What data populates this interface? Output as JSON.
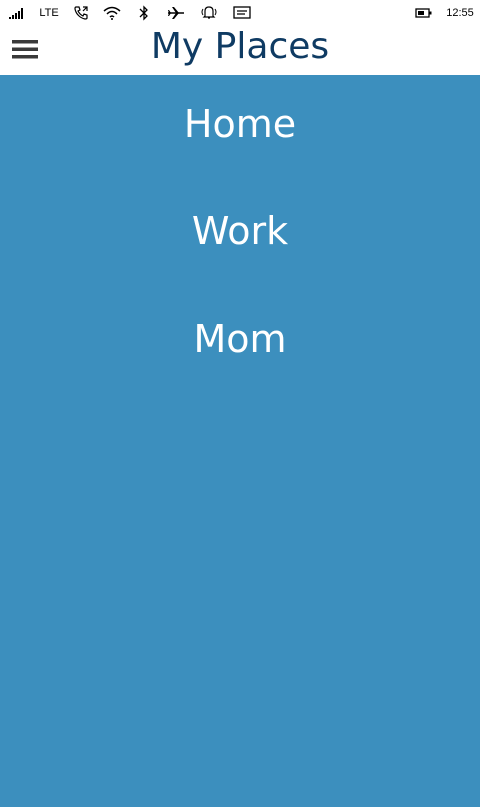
{
  "status_bar": {
    "network": "LTE",
    "time": "12:55",
    "icons": [
      "signal-icon",
      "lte-label",
      "call-icon",
      "wifi-icon",
      "bluetooth-icon",
      "airplane-icon",
      "notification-bell-icon",
      "message-icon",
      "battery-icon"
    ]
  },
  "header": {
    "title": "My Places",
    "menu_icon": "hamburger-menu-icon"
  },
  "places": [
    {
      "label": "Home"
    },
    {
      "label": "Work"
    },
    {
      "label": "Mom"
    }
  ],
  "colors": {
    "accent_blue": "#3c8fbe",
    "title_color": "#0f3b63",
    "header_bg": "#ffffff",
    "item_text": "#ffffff"
  }
}
